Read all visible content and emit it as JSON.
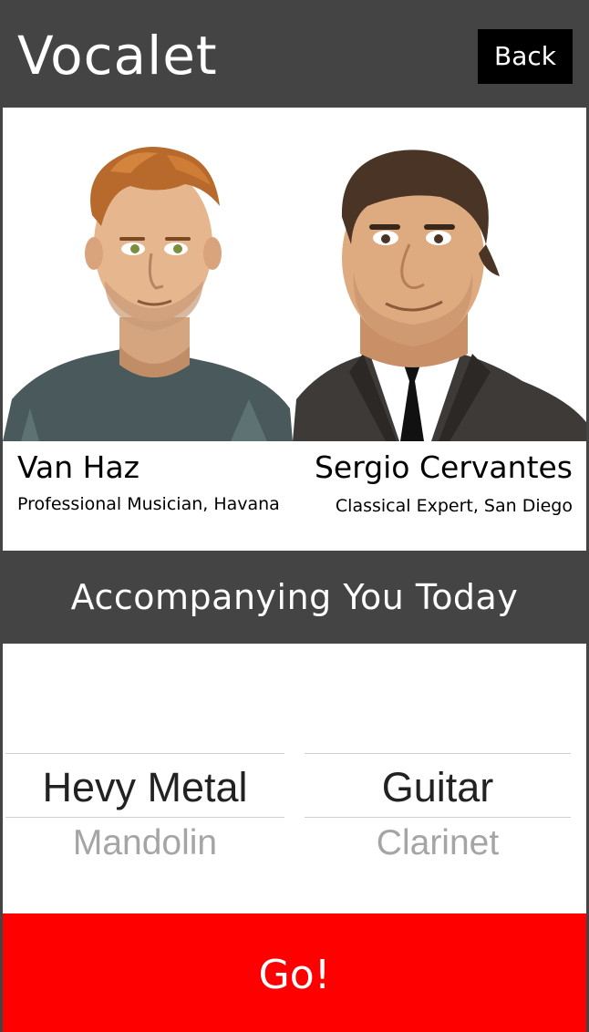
{
  "app": {
    "title": "Vocalet",
    "back_label": "Back"
  },
  "performers": [
    {
      "name": "Van Haz",
      "role": "Professional Musician, Havana"
    },
    {
      "name": "Sergio Cervantes",
      "role": "Classical Expert, San Diego"
    }
  ],
  "section": {
    "heading": "Accompanying You Today"
  },
  "pickers": {
    "genre": {
      "selected": "Hevy Metal",
      "next": "Mandolin"
    },
    "instrument": {
      "selected": "Guitar",
      "next": "Clarinet"
    }
  },
  "go_label": "Go!",
  "colors": {
    "header_bg": "#444444",
    "back_bg": "#000000",
    "go_bg": "#ff0000",
    "picker_selected": "#222222",
    "picker_faded": "#a5a5a5"
  }
}
